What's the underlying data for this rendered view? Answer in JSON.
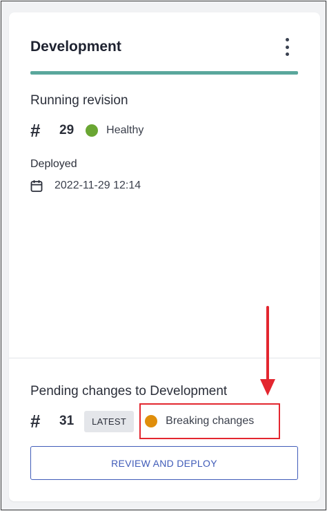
{
  "card": {
    "title": "Development",
    "menu_icon": "more-vertical-icon",
    "accent_color": "#5aa79c"
  },
  "running_revision": {
    "title": "Running revision",
    "number": "29",
    "status": "Healthy",
    "status_color": "#6aa633",
    "deployed_label": "Deployed",
    "deployed_at": "2022-11-29 12:14",
    "date_icon": "calendar-icon"
  },
  "pending": {
    "title": "Pending changes to Development",
    "number": "31",
    "badge": "LATEST",
    "status": "Breaking changes",
    "status_color": "#e08e0b",
    "action_label": "REVIEW AND DEPLOY"
  },
  "annotation": {
    "color": "#e3262f"
  }
}
